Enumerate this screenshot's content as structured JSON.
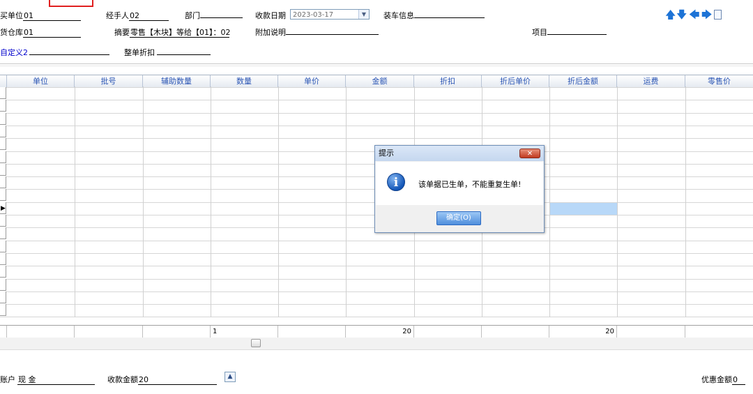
{
  "header": {
    "purchase_unit": {
      "label": "买单位",
      "value": "01"
    },
    "handler": {
      "label": "经手人",
      "value": "02"
    },
    "department": {
      "label": "部门",
      "value": ""
    },
    "payment_date": {
      "label": "收款日期",
      "value": "2023-03-17"
    },
    "shipping_info": {
      "label": "装车信息",
      "value": ""
    },
    "warehouse": {
      "label": "货仓库",
      "value": "01"
    },
    "summary": {
      "label": "摘要",
      "value": "零售【木块】等给【01】：02"
    },
    "note": {
      "label": "附加说明",
      "value": ""
    },
    "project": {
      "label": "项目",
      "value": ""
    },
    "custom2": {
      "label": "自定义2",
      "value": ""
    },
    "whole_discount": {
      "label": "整单折扣",
      "value": ""
    }
  },
  "grid": {
    "columns": [
      "单位",
      "批号",
      "辅助数量",
      "数量",
      "单价",
      "金额",
      "折扣",
      "折后单价",
      "折后金额",
      "运费",
      "零售价"
    ],
    "rows": 18,
    "totals": {
      "qty": "1",
      "amount": "20",
      "discounted_amount": "20"
    }
  },
  "dialog": {
    "title": "提示",
    "close_label": "✕",
    "message": "该单据已生单，不能重复生单!",
    "ok_label": "确定(O)",
    "icon": "info-icon"
  },
  "footer": {
    "account": {
      "label": "账户",
      "value": "现 金"
    },
    "received": {
      "label": "收款金额",
      "value": "20"
    },
    "discount": {
      "label": "优惠金额",
      "value": "0"
    }
  },
  "colors": {
    "accent": "#1d73d6",
    "header_text": "#2a55b4",
    "selection": "#b8d8f8"
  }
}
